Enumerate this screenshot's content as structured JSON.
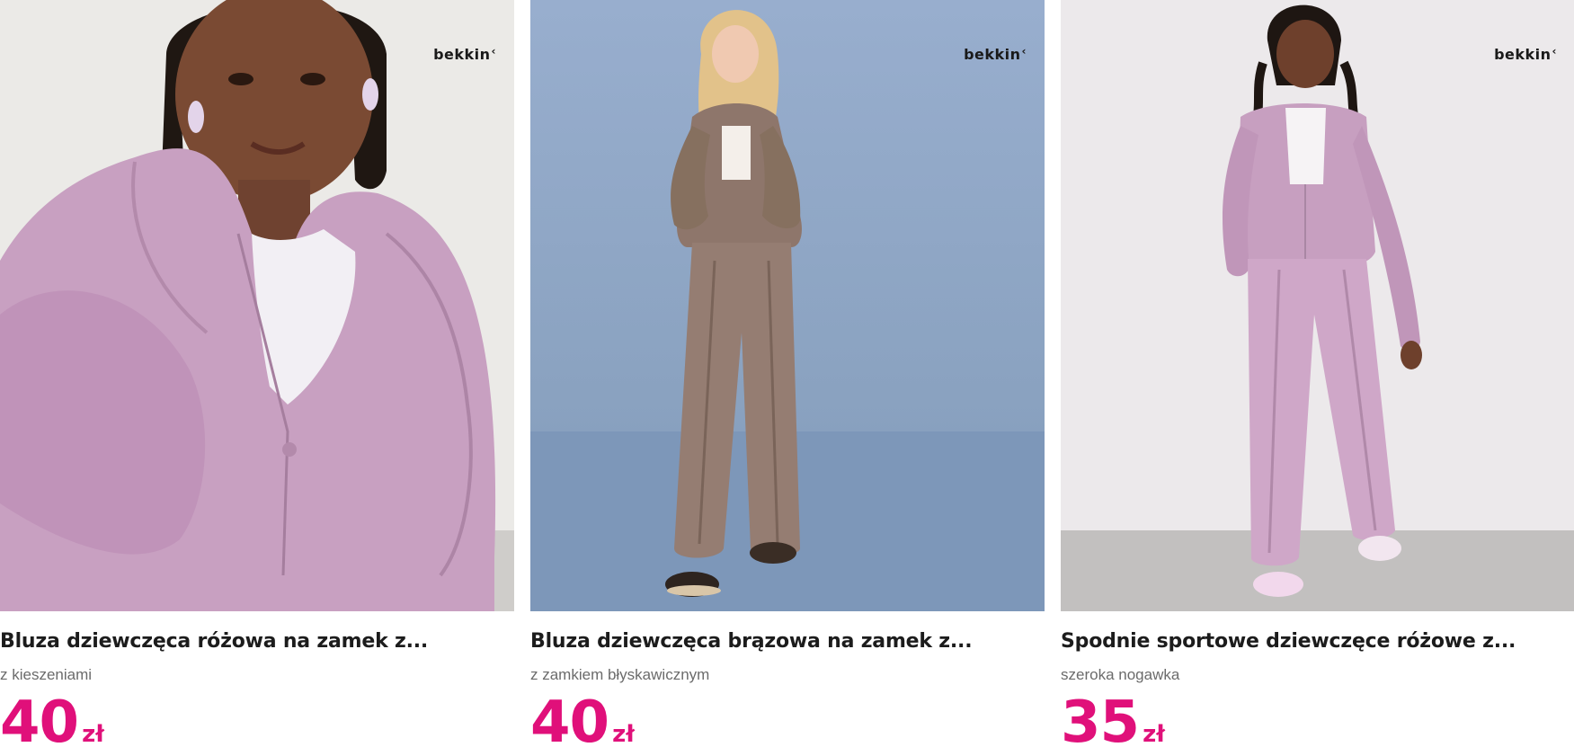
{
  "products": [
    {
      "brand": "bekkin",
      "title": "Bluza dziewczęca różowa na zamek z...",
      "subtitle": "z kieszeniami",
      "price": "40",
      "currency": "zł",
      "image_alt": "girl in pink zip hoodie"
    },
    {
      "brand": "bekkin",
      "title": "Bluza dziewczęca brązowa na zamek z...",
      "subtitle": "z zamkiem błyskawicznym",
      "price": "40",
      "currency": "zł",
      "image_alt": "girl in brown zip hoodie and trousers"
    },
    {
      "brand": "bekkin",
      "title": "Spodnie sportowe dziewczęce różowe z...",
      "subtitle": "szeroka nogawka",
      "price": "35",
      "currency": "zł",
      "image_alt": "girl in pink wide-leg sweatpants"
    }
  ],
  "colors": {
    "price": "#e0107a",
    "title": "#1c1c1c",
    "subtitle": "#6b6b6b",
    "bg_card1": "#ededeb",
    "bg_card2": "#8ea7c4",
    "bg_card3": "#ebe8ea",
    "fabric_pink": "#c79fc0",
    "fabric_brown": "#8e766b"
  }
}
